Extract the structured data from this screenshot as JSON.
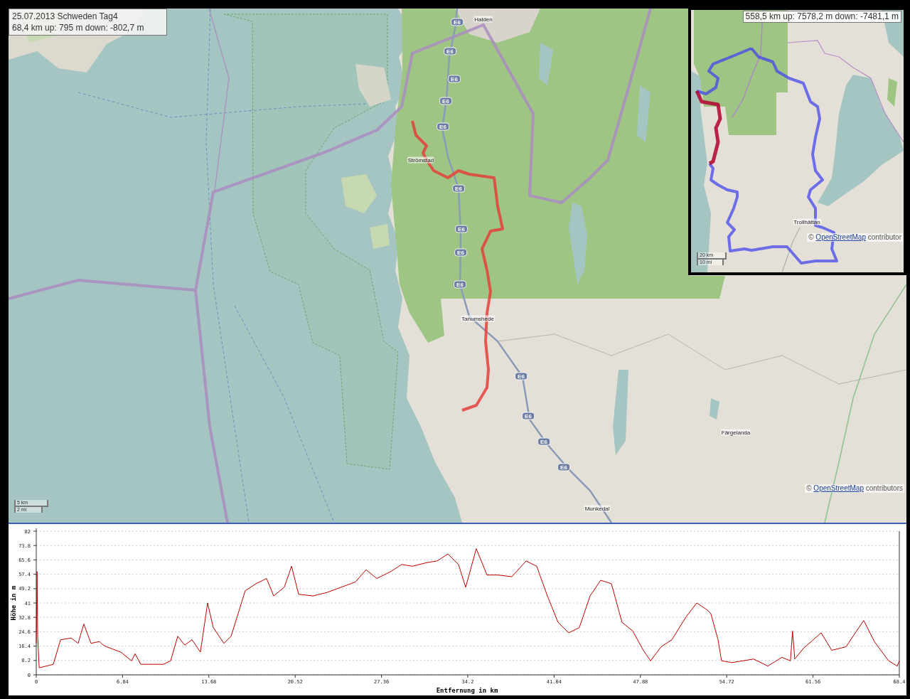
{
  "map": {
    "info_box": {
      "title": "25.07.2013 Schweden Tag4",
      "stats": "68,4 km up: 795 m down: -802,7 m"
    },
    "place_labels": [
      "Halden",
      "Strömstad",
      "Tanumshede",
      "Färgelanda",
      "Munkedal"
    ],
    "road_shields": [
      "E6",
      "E6",
      "E6",
      "E6",
      "E6",
      "E6",
      "E6",
      "E6",
      "E6",
      "E6",
      "E6",
      "E6",
      "E6"
    ],
    "scale": {
      "metric": "5 km",
      "imperial": "2 mi"
    },
    "attribution": {
      "prefix": "©",
      "link": "OpenStreetMap",
      "suffix": "contributors"
    }
  },
  "overview_map": {
    "stats": "558,5 km up: 7578,2 m down: -7481,1 m",
    "place_labels": [
      "Trollhättan"
    ],
    "scale": {
      "metric": "20 km",
      "imperial": "10 mi"
    },
    "attribution": {
      "prefix": "©",
      "link": "OpenStreetMap",
      "suffix": "contributor"
    }
  },
  "elevation_profile": {
    "chart_data": {
      "type": "line",
      "xlabel": "Entfernung in km",
      "ylabel": "Höhe in m",
      "grid": true,
      "xlim": [
        0,
        68.4
      ],
      "ylim": [
        0,
        82
      ],
      "xticks": [
        0,
        6.84,
        13.68,
        20.52,
        27.36,
        34.2,
        41.04,
        47.88,
        54.72,
        61.56,
        68.4
      ],
      "yticks": [
        0,
        8.2,
        16.4,
        24.6,
        32.8,
        41,
        49.2,
        57.4,
        65.6,
        73.8,
        82
      ],
      "x": [
        0,
        0.06,
        0.11,
        0.23,
        0.79,
        1.35,
        1.92,
        2.76,
        3.32,
        3.77,
        4.34,
        5.01,
        5.3,
        5.58,
        6.7,
        7.55,
        7.83,
        8.28,
        10.08,
        10.65,
        11.21,
        11.77,
        12.34,
        13.01,
        13.58,
        14.03,
        14.87,
        15.44,
        16,
        16.56,
        17.41,
        18.25,
        18.82,
        19.66,
        20.23,
        20.79,
        21.92,
        23.04,
        24.17,
        25.3,
        26.14,
        26.99,
        28.11,
        28.96,
        29.8,
        30.93,
        31.77,
        32.62,
        33.46,
        34.03,
        34.87,
        35.72,
        36.56,
        37.69,
        38.82,
        39.66,
        40.51,
        41.35,
        42.2,
        43.04,
        43.89,
        44.73,
        45.58,
        46.42,
        47.27,
        48.11,
        48.68,
        49.52,
        50.37,
        51.49,
        52.34,
        53.18,
        53.46,
        54.03,
        54.31,
        55.15,
        56.85,
        57.97,
        59.1,
        59.77,
        59.94,
        60.11,
        60.79,
        62.2,
        63.04,
        64.17,
        65.58,
        66.42,
        67.55,
        68.23,
        68.4
      ],
      "series": [
        {
          "color": "#c00000",
          "values": [
            18,
            59,
            22,
            4,
            5,
            6,
            20,
            21,
            18,
            29,
            18,
            19,
            17,
            16,
            13,
            8,
            12,
            6,
            6,
            8,
            22,
            17,
            20,
            13,
            41,
            27,
            18,
            22,
            35,
            48,
            52,
            55,
            45,
            50,
            62,
            46,
            45,
            47,
            50,
            53,
            60,
            55,
            59,
            63,
            62,
            64,
            65,
            69,
            63,
            50,
            72,
            57,
            57,
            56,
            65,
            62,
            45,
            30,
            24,
            27,
            45,
            54,
            52,
            30,
            25,
            14,
            8,
            16,
            20,
            33,
            41,
            37,
            35,
            20,
            8,
            7,
            9,
            5,
            10,
            8,
            25,
            9,
            15,
            24,
            14,
            16,
            31,
            19,
            8,
            5,
            8
          ]
        }
      ]
    }
  }
}
